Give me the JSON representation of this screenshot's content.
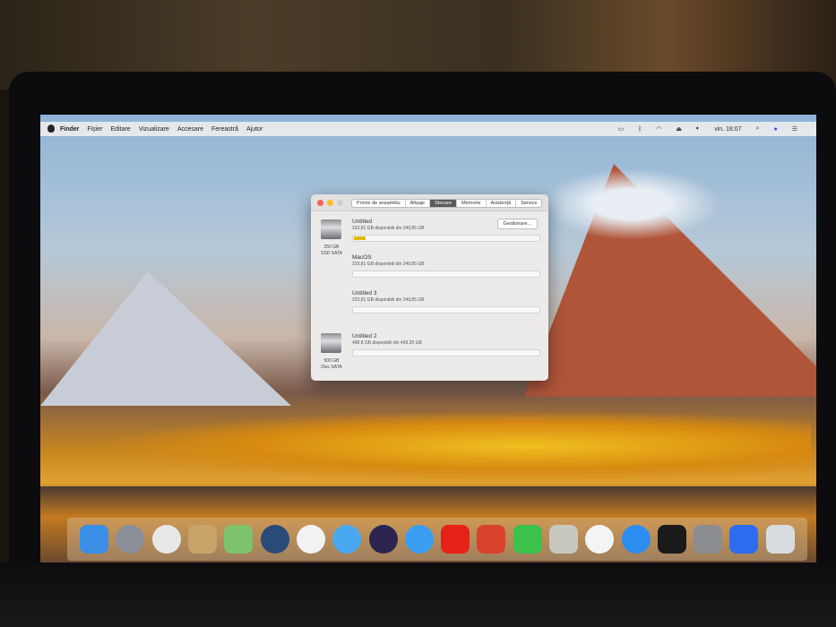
{
  "menubar": {
    "app_name": "Finder",
    "items": [
      "Fișier",
      "Editare",
      "Vizualizare",
      "Accesare",
      "Fereastră",
      "Ajutor"
    ],
    "clock": "vin. 18:07"
  },
  "dialog": {
    "tabs": [
      "Privire de ansamblu",
      "Afișaje",
      "Stocare",
      "Memorie",
      "Asistență",
      "Service"
    ],
    "active_tab": "Stocare",
    "manage_button": "Gestionare...",
    "disks": [
      {
        "capacity": "250 GB",
        "type": "SSD SATA"
      },
      {
        "capacity": "500 GB",
        "type": "Disc SATA"
      }
    ],
    "volumes": [
      {
        "name": "Untitled",
        "info": "233,81 GB disponibili din 249,85 GB",
        "used_fraction": 0.064
      },
      {
        "name": "MacOS",
        "info": "233,81 GB disponibili din 249,85 GB",
        "used_fraction": 0
      },
      {
        "name": "Untitled 3",
        "info": "233,81 GB disponibili din 249,85 GB",
        "used_fraction": 0
      },
      {
        "name": "Untitled 2",
        "info": "498,8 GB disponibili din 499,25 GB",
        "used_fraction": 0
      }
    ]
  },
  "dock": {
    "apps": [
      {
        "icon": "finder-icon",
        "color": "#3a8ee6"
      },
      {
        "icon": "launchpad-icon",
        "color": "#8a8f99"
      },
      {
        "icon": "chrome-icon",
        "color": "#e8e8e8"
      },
      {
        "icon": "contacts-icon",
        "color": "#c9a46a"
      },
      {
        "icon": "maps-icon",
        "color": "#7cc36b"
      },
      {
        "icon": "quicktime-icon",
        "color": "#2a4a7a"
      },
      {
        "icon": "photos-icon",
        "color": "#f2f2f2"
      },
      {
        "icon": "messages-icon",
        "color": "#4aa8f0"
      },
      {
        "icon": "siri-icon",
        "color": "#2b2550"
      },
      {
        "icon": "safari-icon",
        "color": "#3a9ef0"
      },
      {
        "icon": "youtube-icon",
        "color": "#e62117"
      },
      {
        "icon": "photo-booth-icon",
        "color": "#d9432c"
      },
      {
        "icon": "facetime-icon",
        "color": "#3bc24a"
      },
      {
        "icon": "calculator-icon",
        "color": "#c8c8c0"
      },
      {
        "icon": "itunes-icon",
        "color": "#f4f4f6"
      },
      {
        "icon": "app-store-icon",
        "color": "#2d8cf0"
      },
      {
        "icon": "piano-icon",
        "color": "#1a1a1a"
      },
      {
        "icon": "system-preferences-icon",
        "color": "#8a8c90"
      },
      {
        "icon": "zoom-icon",
        "color": "#2d6cf0"
      },
      {
        "icon": "trash-icon",
        "color": "#d8dce0"
      }
    ]
  }
}
